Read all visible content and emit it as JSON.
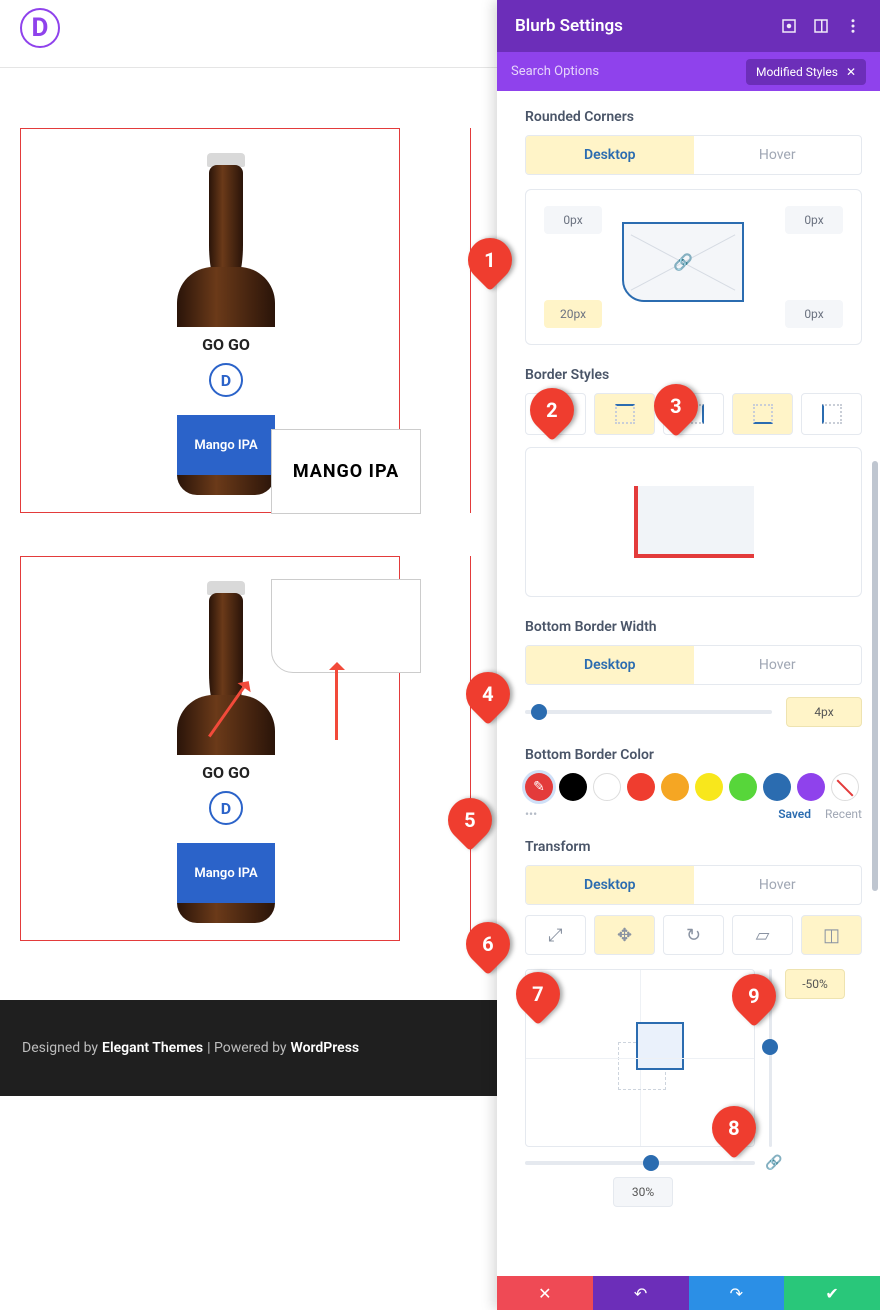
{
  "page": {
    "product_text": "GO GO",
    "product_d": "D",
    "product_flavor": "Mango IPA",
    "card_title": "MANGO IPA",
    "footer_prefix": "Designed by",
    "footer_theme": "Elegant Themes",
    "footer_mid": " | Powered by ",
    "footer_cms": "WordPress"
  },
  "panel": {
    "title": "Blurb Settings",
    "search_placeholder": "Search Options",
    "modified_badge": "Modified Styles",
    "sections": {
      "rounded": "Rounded Corners",
      "border_styles": "Border Styles",
      "bbw": "Bottom Border Width",
      "bbc": "Bottom Border Color",
      "transform": "Transform"
    },
    "tabs": {
      "desktop": "Desktop",
      "hover": "Hover"
    },
    "corners": {
      "tl": "0px",
      "tr": "0px",
      "bl": "20px",
      "br": "0px"
    },
    "bbw_value": "4px",
    "colors": {
      "swatches": [
        "#e33b3b",
        "#000000",
        "#ffffff",
        "#ef3d2f",
        "#f5a623",
        "#f8e71c",
        "#57d63a",
        "#2b6cb0",
        "#8f42ec"
      ],
      "saved_label": "Saved",
      "recent_label": "Recent"
    },
    "transform_y": "-50%",
    "transform_x": "30%"
  },
  "markers": [
    "1",
    "2",
    "3",
    "4",
    "5",
    "6",
    "7",
    "8",
    "9"
  ]
}
